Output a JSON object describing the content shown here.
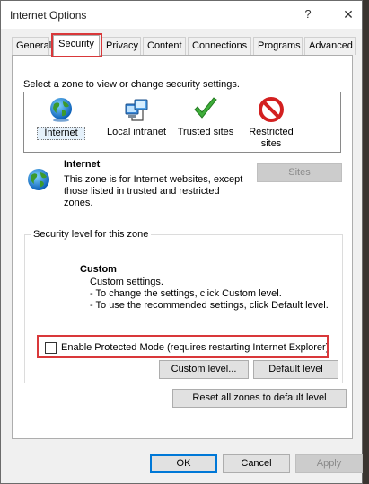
{
  "window": {
    "title": "Internet Options",
    "help_glyph": "?",
    "close_glyph": "✕"
  },
  "tabs": [
    {
      "label": "General"
    },
    {
      "label": "Security",
      "active": true
    },
    {
      "label": "Privacy"
    },
    {
      "label": "Content"
    },
    {
      "label": "Connections"
    },
    {
      "label": "Programs"
    },
    {
      "label": "Advanced"
    }
  ],
  "security": {
    "zone_prompt": "Select a zone to view or change security settings.",
    "zones": [
      {
        "label": "Internet",
        "icon": "globe-icon",
        "selected": true
      },
      {
        "label": "Local intranet",
        "icon": "network-computer-icon"
      },
      {
        "label": "Trusted sites",
        "icon": "checkmark-icon"
      },
      {
        "label": "Restricted sites",
        "icon": "restricted-icon"
      }
    ],
    "selected_zone": {
      "title": "Internet",
      "description": "This zone is for Internet websites, except those listed in trusted and restricted zones."
    },
    "sites_button": "Sites",
    "level_group_label": "Security level for this zone",
    "level_name": "Custom",
    "level_lines": [
      "Custom settings.",
      "- To change the settings, click Custom level.",
      "- To use the recommended settings, click Default level."
    ],
    "protected_mode_label": "Enable Protected Mode (requires restarting Internet Explorer)",
    "protected_mode_checked": false,
    "custom_level_button": "Custom level...",
    "default_level_button": "Default level",
    "reset_all_button": "Reset all zones to default level"
  },
  "footer": {
    "ok": "OK",
    "cancel": "Cancel",
    "apply": "Apply"
  },
  "colors": {
    "highlight": "#d9383a",
    "accent": "#0078d7"
  }
}
